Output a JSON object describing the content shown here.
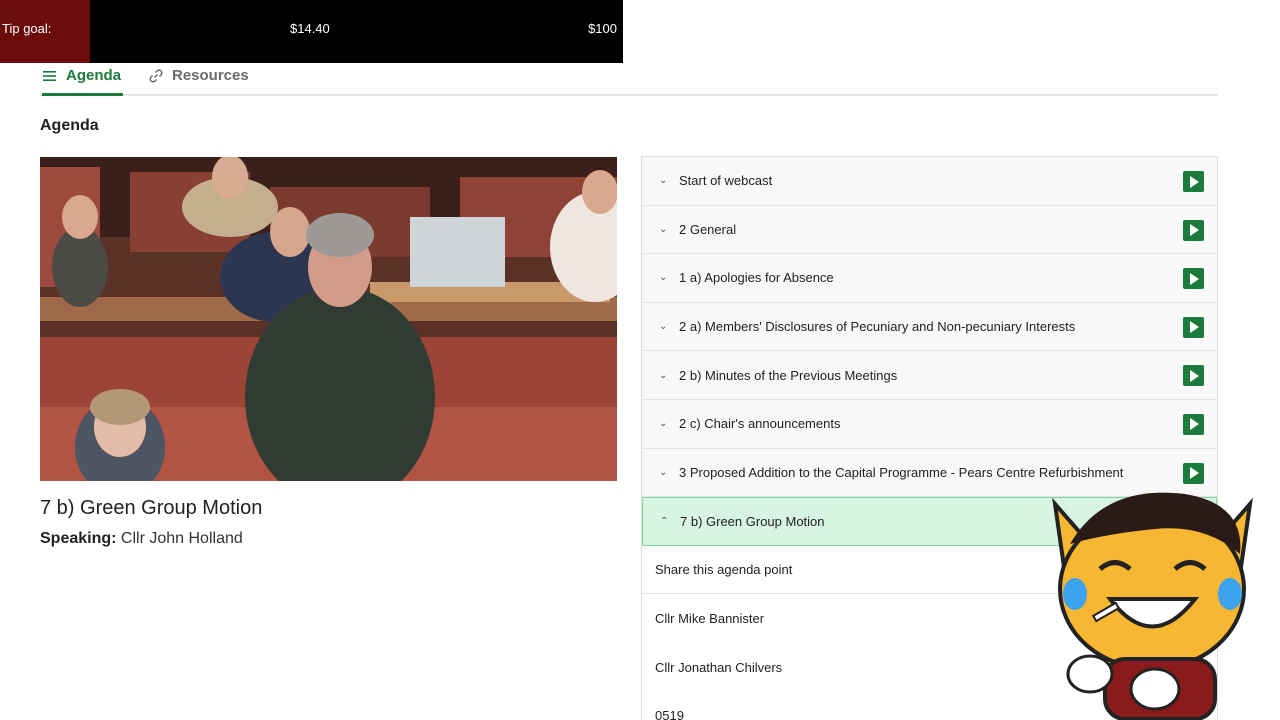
{
  "tip_goal": {
    "label": "Tip goal:",
    "current": "$14.40",
    "target": "$100",
    "progress_fraction": 0.144,
    "fill_color": "#6b0c0c"
  },
  "tabs": [
    {
      "label": "Agenda",
      "icon": "menu-lines-icon",
      "active": true
    },
    {
      "label": "Resources",
      "icon": "link-icon",
      "active": false
    }
  ],
  "section_title": "Agenda",
  "now_playing": {
    "title": "7 b) Green Group Motion",
    "speaking_label": "Speaking:",
    "speaker": "Cllr John Holland"
  },
  "agenda_items": [
    {
      "label": "Start of webcast",
      "expanded": false
    },
    {
      "label": "2 General",
      "expanded": false
    },
    {
      "label": "1 a) Apologies for Absence",
      "expanded": false
    },
    {
      "label": "2 a) Members' Disclosures of Pecuniary and Non-pecuniary Interests",
      "expanded": false
    },
    {
      "label": "2 b) Minutes of the Previous Meetings",
      "expanded": false
    },
    {
      "label": "2 c) Chair's announcements",
      "expanded": false
    },
    {
      "label": "3 Proposed Addition to the Capital Programme - Pears Centre Refurbishment",
      "expanded": false
    },
    {
      "label": "7 b) Green Group Motion",
      "expanded": true
    }
  ],
  "expanded_details": {
    "share_label": "Share this agenda point",
    "speakers": [
      "Cllr Mike Bannister",
      "Cllr Jonathan Chilvers",
      "0519"
    ]
  },
  "colors": {
    "accent_green": "#1b7a3c",
    "expanded_bg": "#d8f5e3"
  }
}
